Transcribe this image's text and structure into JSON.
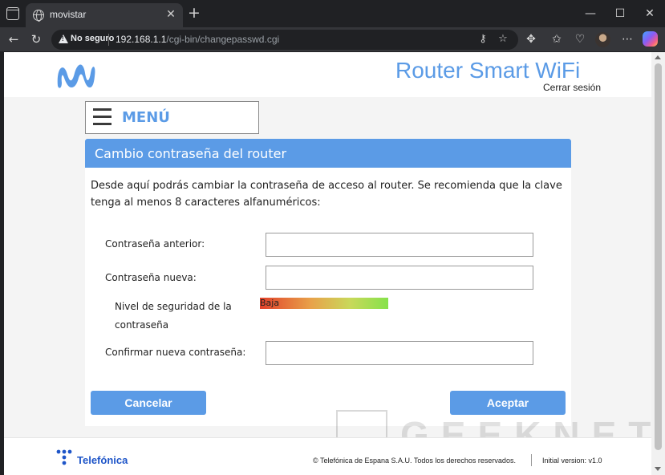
{
  "browser": {
    "tab_title": "movistar",
    "security_label": "No seguro",
    "url_host": "192.168.1.1",
    "url_path": "/cgi-bin/changepasswd.cgi",
    "window_controls": {
      "minimize": "—",
      "maximize": "☐",
      "close": "✕"
    },
    "icons": {
      "tab_actions": "tab-actions-icon",
      "globe": "globe-icon",
      "back": "back-arrow-icon",
      "reload": "reload-icon",
      "key": "key-icon",
      "favorite": "star-icon",
      "extensions": "puzzle-icon",
      "favorites_bar": "favorites-icon",
      "health": "heart-pulse-icon",
      "profile": "avatar",
      "more": "more-icon",
      "copilot": "copilot-icon"
    }
  },
  "header": {
    "title": "Router Smart WiFi",
    "logout": "Cerrar sesión",
    "brand_color": "#5b9be6"
  },
  "menu": {
    "label": "MENÚ"
  },
  "card": {
    "title": "Cambio contraseña del router",
    "intro": "Desde aquí podrás cambiar la contraseña de acceso al router. Se recomienda que la clave tenga al menos 8 caracteres alfanuméricos:"
  },
  "form": {
    "old_password_label": "Contraseña anterior:",
    "old_password_value": "",
    "new_password_label": "Contraseña nueva:",
    "new_password_value": "",
    "strength_label": "Nivel de seguridad de la contraseña",
    "strength_value": "Baja",
    "confirm_label": "Confirmar nueva contraseña:",
    "confirm_value": ""
  },
  "buttons": {
    "cancel": "Cancelar",
    "accept": "Aceptar"
  },
  "watermark": {
    "text": "GEEKNETIC"
  },
  "footer": {
    "brand": "Telefónica",
    "copyright": "© Telefónica de Espana S.A.U. Todos los derechos reservados.",
    "version": "Initial version: v1.0"
  }
}
